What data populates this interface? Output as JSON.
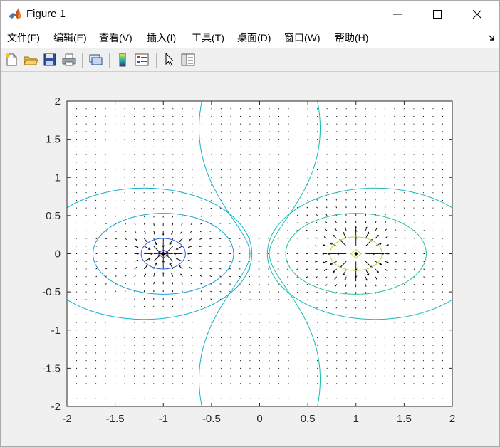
{
  "window": {
    "title": "Figure 1",
    "controls": {
      "minimize": "minimize",
      "maximize": "maximize",
      "close": "close"
    }
  },
  "menu": {
    "items": [
      {
        "id": "file",
        "label": "文件(F)"
      },
      {
        "id": "edit",
        "label": "编辑(E)"
      },
      {
        "id": "view",
        "label": "查看(V)"
      },
      {
        "id": "insert",
        "label": "插入(I)"
      },
      {
        "id": "tools",
        "label": "工具(T)"
      },
      {
        "id": "desktop",
        "label": "桌面(D)"
      },
      {
        "id": "window",
        "label": "窗口(W)"
      },
      {
        "id": "help",
        "label": "帮助(H)"
      }
    ]
  },
  "toolbar": {
    "buttons": [
      {
        "id": "new",
        "icon": "new-figure-icon"
      },
      {
        "id": "open",
        "icon": "open-file-icon"
      },
      {
        "id": "save",
        "icon": "save-icon"
      },
      {
        "id": "print",
        "icon": "print-icon"
      },
      {
        "id": "link",
        "icon": "link-plot-icon"
      },
      {
        "id": "colorbar",
        "icon": "colorbar-icon"
      },
      {
        "id": "legend",
        "icon": "legend-icon"
      },
      {
        "id": "edit-plot",
        "icon": "pointer-icon"
      },
      {
        "id": "property-inspector",
        "icon": "property-inspector-icon"
      }
    ]
  },
  "chart_data": {
    "type": "contour",
    "description_source": "contour lines of a two-point-charge potential with quiver field arrows",
    "xlim": [
      -2,
      2
    ],
    "ylim": [
      -2,
      2
    ],
    "xticks": [
      "-2",
      "-1.5",
      "-1",
      "-0.5",
      "0",
      "0.5",
      "1",
      "1.5",
      "2"
    ],
    "yticks": [
      "2",
      "1.5",
      "1",
      "0.5",
      "0",
      "-0.5",
      "-1",
      "-1.5",
      "-2"
    ],
    "charges": [
      {
        "x": -1,
        "y": 0,
        "sign": "negative"
      },
      {
        "x": 1,
        "y": 0,
        "sign": "positive"
      }
    ],
    "contours": [
      {
        "center_x": -1,
        "rx": 0.055,
        "ry": 0.055,
        "shape": "diamond",
        "color": "#5b3fd1"
      },
      {
        "center_x": -1,
        "rx": 0.23,
        "ry": 0.2,
        "shape": "ellipse",
        "color": "#3060e0"
      },
      {
        "center_x": -1,
        "rx": 0.73,
        "ry": 0.53,
        "shape": "ellipse",
        "color": "#1aa0d8"
      },
      {
        "center_x": -1.2,
        "rx": 1.12,
        "ry": 0.86,
        "shape": "ellipse",
        "color": "#12b3cf"
      },
      {
        "center_x": 1,
        "rx": 0.055,
        "ry": 0.055,
        "shape": "diamond",
        "color": "#b9c93a"
      },
      {
        "center_x": 1,
        "rx": 0.27,
        "ry": 0.22,
        "shape": "ellipse",
        "color": "#c6d040"
      },
      {
        "center_x": 1,
        "rx": 0.73,
        "ry": 0.53,
        "shape": "ellipse",
        "color": "#2cc0a0"
      },
      {
        "center_x": 1.2,
        "rx": 1.12,
        "ry": 0.86,
        "shape": "ellipse",
        "color": "#22b8b8"
      }
    ],
    "zero_lines": [
      {
        "side": "left",
        "x_at_y0": -0.1,
        "x_at_ymax": -0.6,
        "color": "#13b5c8"
      },
      {
        "side": "right",
        "x_at_y0": 0.1,
        "x_at_ymax": 0.6,
        "color": "#16bfae"
      }
    ],
    "quiver_grid_step": 0.1,
    "grid": false
  },
  "colors": {
    "axes_bg": "#ffffff",
    "axes_frame": "#262626",
    "tick_text": "#262626",
    "arrow": "#000000"
  }
}
